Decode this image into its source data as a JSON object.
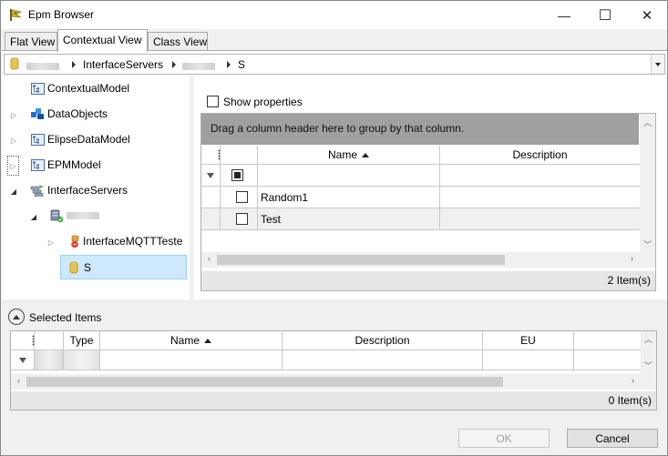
{
  "window": {
    "title": "Epm Browser",
    "minimize_glyph": "—",
    "maximize_glyph": "☐",
    "close_glyph": "✕"
  },
  "tabs": [
    {
      "label": "Flat View",
      "active": false
    },
    {
      "label": "Contextual View",
      "active": true
    },
    {
      "label": "Class View",
      "active": false
    }
  ],
  "breadcrumb": {
    "items": [
      "InterfaceServers",
      "S"
    ]
  },
  "tree": {
    "items": [
      {
        "label": "ContextualModel",
        "icon": "model-icon"
      },
      {
        "label": "DataObjects",
        "icon": "dataobjects-icon"
      },
      {
        "label": "ElipseDataModel",
        "icon": "model-icon"
      },
      {
        "label": "EPMModel",
        "icon": "model-icon"
      },
      {
        "label": "InterfaceServers",
        "icon": "servers-icon"
      },
      {
        "label": "",
        "icon": "server-icon"
      },
      {
        "label": "InterfaceMQTTTeste",
        "icon": "interface-icon"
      },
      {
        "label": "S",
        "icon": "database-icon",
        "selected": true
      }
    ]
  },
  "properties": {
    "show_properties_label": "Show properties",
    "show_properties_checked": false,
    "group_panel_text": "Drag a column header here to group by that column.",
    "columns": [
      "Name",
      "Description"
    ],
    "rows": [
      {
        "name": "Random1",
        "description": ""
      },
      {
        "name": "Test",
        "description": ""
      }
    ],
    "status": "2 Item(s)"
  },
  "selected_items": {
    "label": "Selected Items",
    "columns": [
      "Type",
      "Name",
      "Description",
      "EU"
    ],
    "status": "0 Item(s)"
  },
  "buttons": {
    "ok": "OK",
    "cancel": "Cancel"
  },
  "colors": {
    "selection": "#cde8ff",
    "group_panel": "#a0a0a0",
    "accent": "#99d1ff"
  }
}
